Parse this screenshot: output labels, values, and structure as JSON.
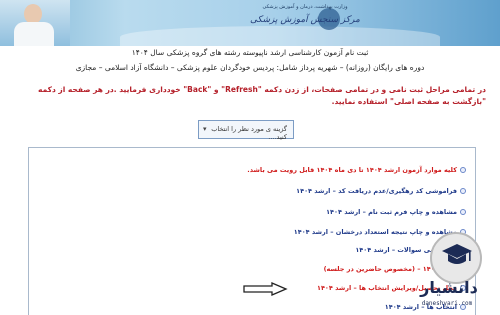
{
  "banner": {
    "ministry_line1": "وزارت بهداشت، درمان و آموزش پزشکی",
    "ministry_line2": "مرکز سنجش آموزش پزشکی"
  },
  "header": {
    "title": "ثبت نام آزمون کارشناسی ارشد ناپیوسته رشته های گروه پزشکی سال ۱۴۰۴",
    "subtitle1": "دوره های رایگان (روزانه) – شهریه پرداز شامل: پردیس خودگردان علوم پزشکی – دانشگاه آزاد اسلامی – مجازی",
    "warning": "در تمامی مراحل ثبت نامی و در تمامی صفحات، از زدن دکمه \"Refresh\" و \"Back\" خودداری فرمایید .در هر صفحه از دکمه \"بازگشت به صفحه اصلی\" استفاده نمایید."
  },
  "select": {
    "placeholder": "گزینه ی مورد نظر را انتخاب کنید....",
    "chevron": "▾"
  },
  "menu": {
    "items": [
      {
        "label": "کلیه موارد آزمون ارشد ۱۴۰۴ تا دی ماه ۱۴۰۴ قابل رویت می باشد.",
        "color": "red"
      },
      {
        "label": "فراموشی کد رهگیری/عدم دریافت کد – ارشد ۱۴۰۴",
        "color": "blue"
      },
      {
        "label": "مشاهده و چاپ فرم ثبت نام – ارشد ۱۴۰۴",
        "color": "blue"
      },
      {
        "label": "مشاهده و چاپ نتیجه استعداد درخشان – ارشد ۱۴۰۴",
        "color": "blue"
      },
      {
        "label": "کلید نهایی سوالات – ارشد ۱۴۰۴",
        "color": "blue"
      },
      {
        "label": "ارشد ۱۴۰۴ – (مخصوص حاضرین در جلسه)",
        "color": "red"
      },
      {
        "label": "محل تحصیل/ویرایش انتخاب ها – ارشد ۱۴۰۴",
        "color": "red"
      },
      {
        "label": "انتخاب ها – ارشد ۱۴۰۴",
        "color": "blue"
      }
    ]
  },
  "logo": {
    "name": "دانشیار",
    "url": "daneshyari.com"
  },
  "colors": {
    "accent_blue": "#1f3a8a",
    "alert_red": "#d01b1b",
    "warning_red": "#b5202a"
  },
  "icons": {
    "arrow": "arrow-right-icon",
    "logo": "graduation-cap-icon"
  }
}
